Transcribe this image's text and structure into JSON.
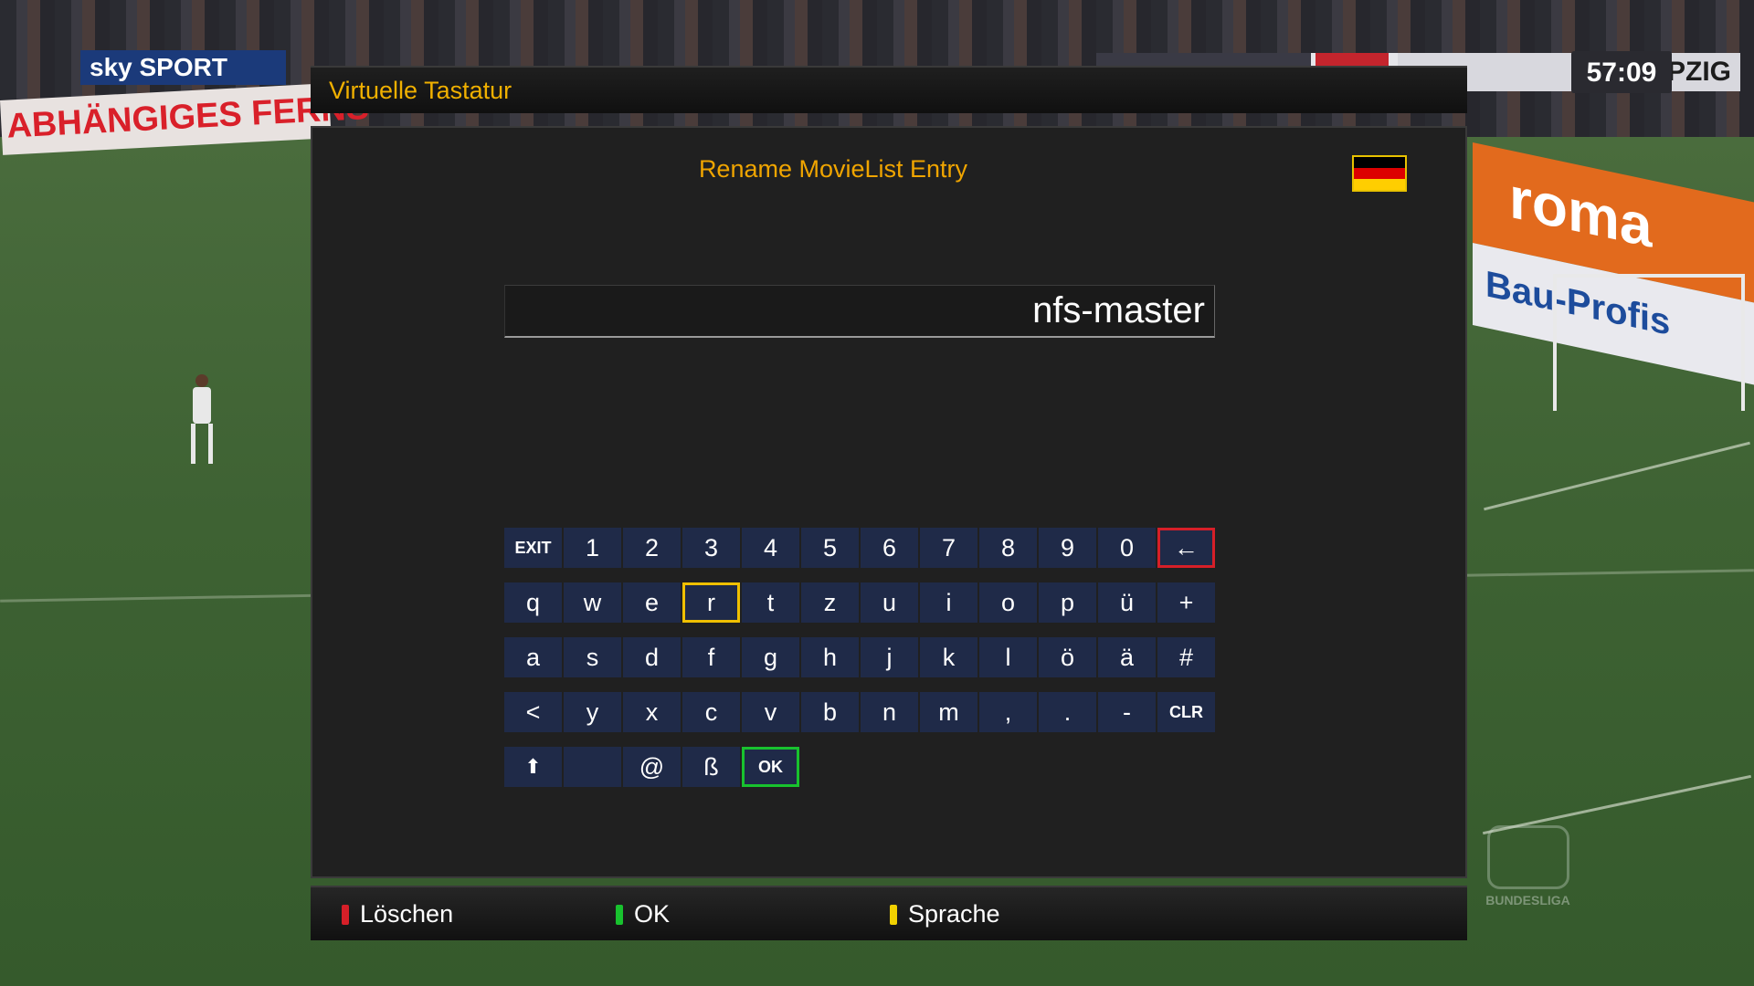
{
  "dialog": {
    "title": "Virtuelle Tastatur",
    "prompt": "Rename MovieList Entry",
    "input_value": "nfs-master",
    "language_flag": "de-flag-icon"
  },
  "keyboard": {
    "rows": [
      [
        "EXIT",
        "1",
        "2",
        "3",
        "4",
        "5",
        "6",
        "7",
        "8",
        "9",
        "0",
        "←"
      ],
      [
        "q",
        "w",
        "e",
        "r",
        "t",
        "z",
        "u",
        "i",
        "o",
        "p",
        "ü",
        "+"
      ],
      [
        "a",
        "s",
        "d",
        "f",
        "g",
        "h",
        "j",
        "k",
        "l",
        "ö",
        "ä",
        "#"
      ],
      [
        "<",
        "y",
        "x",
        "c",
        "v",
        "b",
        "n",
        "m",
        ",",
        ".",
        "-",
        "CLR"
      ],
      [
        "⬆",
        "",
        "@",
        "ß",
        "OK"
      ]
    ],
    "selected_key": "r",
    "key_color": "#1f2a48",
    "highlight_colors": {
      "selected": "#f0c000",
      "backspace": "#d61f28",
      "ok": "#18c22e"
    }
  },
  "buttons": [
    {
      "label": "Löschen",
      "color": "#d61f28"
    },
    {
      "label": "OK",
      "color": "#18c22e"
    },
    {
      "label": "Sprache",
      "color": "#f0d000"
    }
  ],
  "background": {
    "channel": "sky SPORT",
    "scorebug_away": "EIPZIG",
    "match_clock": "57:09",
    "ad_left": "ABHÄNGIGES FERNS",
    "ad_right": "roma",
    "ad_right2": "Bau-Profis",
    "league_logo": "BUNDESLIGA"
  },
  "colors": {
    "title": "#f0b000",
    "prompt": "#f0a500",
    "dialog_bg": "#202020"
  }
}
